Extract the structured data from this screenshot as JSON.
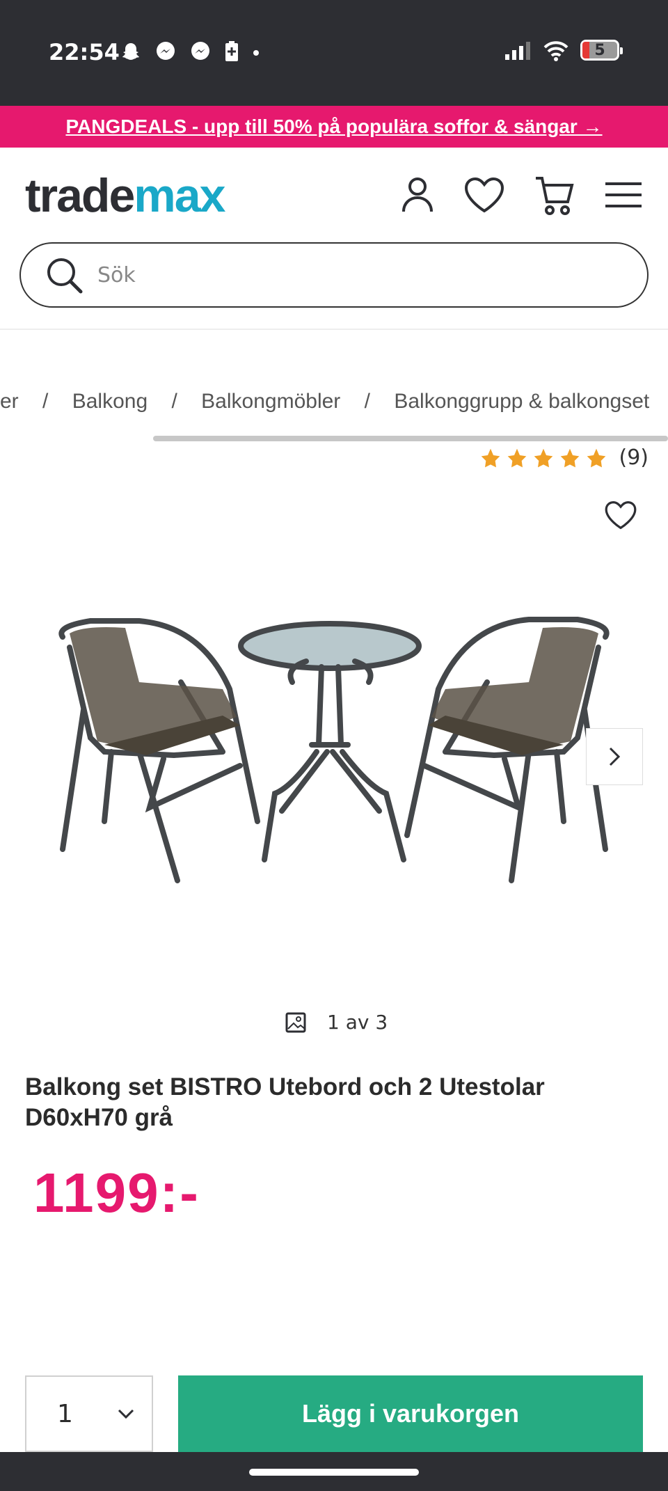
{
  "status_bar": {
    "time": "22:54",
    "battery": "5"
  },
  "promo": {
    "text": "PANGDEALS - upp till 50% på populära soffor & sängar →"
  },
  "header": {
    "logo_part1": "trade",
    "logo_part2": "max"
  },
  "search": {
    "placeholder": "Sök"
  },
  "breadcrumb": {
    "items": [
      "er",
      "Balkong",
      "Balkongmöbler",
      "Balkonggrupp & balkongset"
    ],
    "separator": "/"
  },
  "rating": {
    "stars": 5,
    "count": "(9)"
  },
  "gallery": {
    "counter": "1 av 3"
  },
  "product": {
    "title": "Balkong set BISTRO Utebord och 2 Utestolar D60xH70 grå",
    "price": "1199:-"
  },
  "purchase": {
    "quantity": "1",
    "add_to_cart": "Lägg i varukorgen"
  },
  "colors": {
    "brand_pink": "#e6196e",
    "logo_blue": "#1aa8c8",
    "cta_green": "#26ab82",
    "star": "#f0a026"
  }
}
